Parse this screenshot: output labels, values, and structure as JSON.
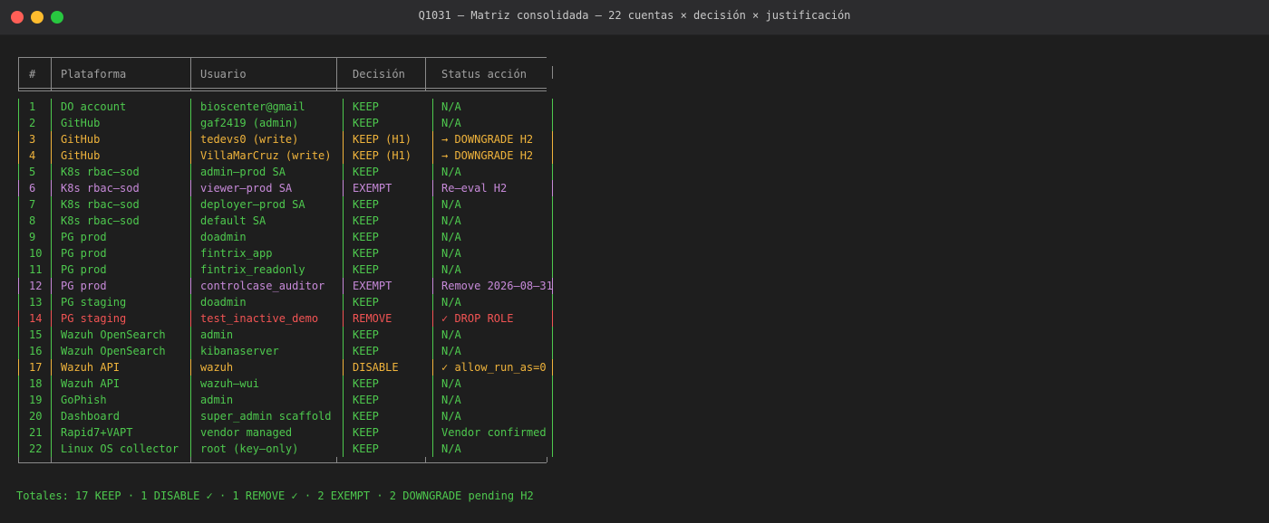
{
  "window": {
    "title": "Q1031 — Matriz consolidada — 22 cuentas × decisión × justificación"
  },
  "colors": {
    "green": "#4ec94e",
    "yellow": "#f0b43c",
    "purple": "#c78ad9",
    "red": "#f25454",
    "border": "#8a8a8a",
    "header": "#a0a0a0"
  },
  "table": {
    "headers": [
      "#",
      "Plataforma",
      "Usuario",
      "Decisión",
      "Status acción"
    ],
    "rows": [
      {
        "n": "1",
        "platform": "DO account",
        "user": "bioscenter@gmail",
        "decision": "KEEP",
        "status": "N/A",
        "color": "green"
      },
      {
        "n": "2",
        "platform": "GitHub",
        "user": "gaf2419 (admin)",
        "decision": "KEEP",
        "status": "N/A",
        "color": "green"
      },
      {
        "n": "3",
        "platform": "GitHub",
        "user": "tedevs0 (write)",
        "decision": "KEEP (H1)",
        "status": "→ DOWNGRADE H2",
        "color": "yellow"
      },
      {
        "n": "4",
        "platform": "GitHub",
        "user": "VillaMarCruz (write)",
        "decision": "KEEP (H1)",
        "status": "→ DOWNGRADE H2",
        "color": "yellow"
      },
      {
        "n": "5",
        "platform": "K8s rbac–sod",
        "user": "admin–prod SA",
        "decision": "KEEP",
        "status": "N/A",
        "color": "green"
      },
      {
        "n": "6",
        "platform": "K8s rbac–sod",
        "user": "viewer–prod SA",
        "decision": "EXEMPT",
        "status": "Re–eval H2",
        "color": "purple"
      },
      {
        "n": "7",
        "platform": "K8s rbac–sod",
        "user": "deployer–prod SA",
        "decision": "KEEP",
        "status": "N/A",
        "color": "green"
      },
      {
        "n": "8",
        "platform": "K8s rbac–sod",
        "user": "default SA",
        "decision": "KEEP",
        "status": "N/A",
        "color": "green"
      },
      {
        "n": "9",
        "platform": "PG prod",
        "user": "doadmin",
        "decision": "KEEP",
        "status": "N/A",
        "color": "green"
      },
      {
        "n": "10",
        "platform": "PG prod",
        "user": "fintrix_app",
        "decision": "KEEP",
        "status": "N/A",
        "color": "green"
      },
      {
        "n": "11",
        "platform": "PG prod",
        "user": "fintrix_readonly",
        "decision": "KEEP",
        "status": "N/A",
        "color": "green"
      },
      {
        "n": "12",
        "platform": "PG prod",
        "user": "controlcase_auditor",
        "decision": "EXEMPT",
        "status": "Remove 2026–08–31",
        "color": "purple"
      },
      {
        "n": "13",
        "platform": "PG staging",
        "user": "doadmin",
        "decision": "KEEP",
        "status": "N/A",
        "color": "green"
      },
      {
        "n": "14",
        "platform": "PG staging",
        "user": "test_inactive_demo",
        "decision": "REMOVE",
        "status": "✓ DROP ROLE",
        "color": "red"
      },
      {
        "n": "15",
        "platform": "Wazuh OpenSearch",
        "user": "admin",
        "decision": "KEEP",
        "status": "N/A",
        "color": "green"
      },
      {
        "n": "16",
        "platform": "Wazuh OpenSearch",
        "user": "kibanaserver",
        "decision": "KEEP",
        "status": "N/A",
        "color": "green"
      },
      {
        "n": "17",
        "platform": "Wazuh API",
        "user": "wazuh",
        "decision": "DISABLE",
        "status": "✓ allow_run_as=0",
        "color": "yellow"
      },
      {
        "n": "18",
        "platform": "Wazuh API",
        "user": "wazuh–wui",
        "decision": "KEEP",
        "status": "N/A",
        "color": "green"
      },
      {
        "n": "19",
        "platform": "GoPhish",
        "user": "admin",
        "decision": "KEEP",
        "status": "N/A",
        "color": "green"
      },
      {
        "n": "20",
        "platform": "Dashboard",
        "user": "super_admin scaffold",
        "decision": "KEEP",
        "status": "N/A",
        "color": "green"
      },
      {
        "n": "21",
        "platform": "Rapid7+VAPT",
        "user": "vendor managed",
        "decision": "KEEP",
        "status": "Vendor confirmed",
        "color": "green"
      },
      {
        "n": "22",
        "platform": "Linux OS collector",
        "user": "root (key–only)",
        "decision": "KEEP",
        "status": "N/A",
        "color": "green"
      }
    ]
  },
  "totals": "Totales: 17 KEEP · 1 DISABLE ✓ · 1 REMOVE ✓ · 2 EXEMPT · 2 DOWNGRADE pending H2"
}
